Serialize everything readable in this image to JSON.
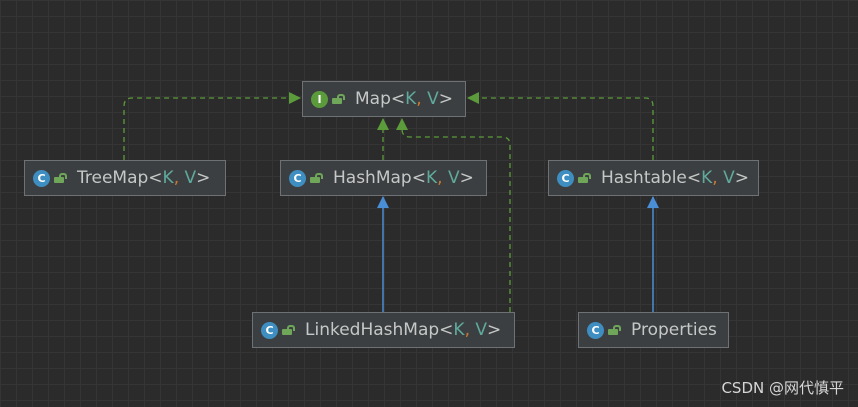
{
  "diagram": {
    "nodes": [
      {
        "id": "map",
        "kind": "interface",
        "badge": "I",
        "name": "Map",
        "lt": "<",
        "k": "K",
        "comma": ",",
        "v": "V",
        "gt": ">"
      },
      {
        "id": "treemap",
        "kind": "class",
        "badge": "C",
        "name": "TreeMap",
        "lt": "<",
        "k": "K",
        "comma": ",",
        "v": "V",
        "gt": ">"
      },
      {
        "id": "hashmap",
        "kind": "class",
        "badge": "C",
        "name": "HashMap",
        "lt": "<",
        "k": "K",
        "comma": ",",
        "v": "V",
        "gt": ">"
      },
      {
        "id": "hashtable",
        "kind": "class",
        "badge": "C",
        "name": "Hashtable",
        "lt": "<",
        "k": "K",
        "comma": ",",
        "v": "V",
        "gt": ">"
      },
      {
        "id": "linkedhashmap",
        "kind": "class",
        "badge": "C",
        "name": "LinkedHashMap",
        "lt": "<",
        "k": "K",
        "comma": ",",
        "v": "V",
        "gt": ">"
      },
      {
        "id": "properties",
        "kind": "class",
        "badge": "C",
        "name": "Properties"
      }
    ],
    "edges": [
      {
        "from": "treemap",
        "to": "map",
        "type": "implements"
      },
      {
        "from": "hashmap",
        "to": "map",
        "type": "implements"
      },
      {
        "from": "linkedhashmap",
        "to": "map",
        "type": "implements"
      },
      {
        "from": "hashtable",
        "to": "map",
        "type": "implements"
      },
      {
        "from": "linkedhashmap",
        "to": "hashmap",
        "type": "extends"
      },
      {
        "from": "properties",
        "to": "hashtable",
        "type": "extends"
      }
    ],
    "colors": {
      "implements": "#5c9b3b",
      "extends": "#4a8fd6",
      "class_badge": "#3f8ec1",
      "interface_badge": "#5c9b3b",
      "type_param": "#5faa9c",
      "comma": "#cc7832"
    }
  },
  "watermark": "CSDN @网代慎平"
}
